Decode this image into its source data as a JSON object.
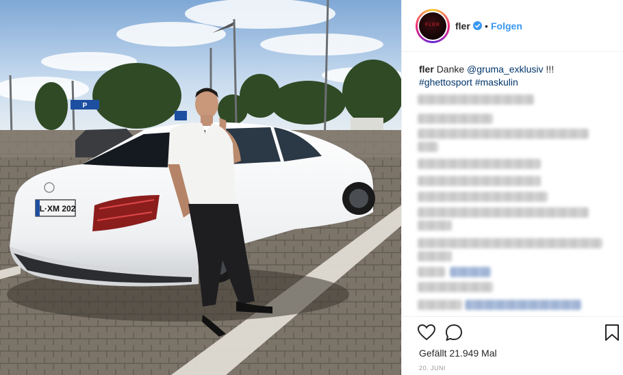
{
  "post": {
    "username": "fler",
    "follow_label": "Folgen",
    "separator": "•",
    "avatar_text": "FLER",
    "caption": {
      "user": "fler",
      "text_before": "Danke",
      "mention": "@gruma_exklusiv",
      "text_after": "!!!",
      "hashtag_1": "#ghettosport",
      "hashtag_2": "#maskulin"
    },
    "likes_label": "Gefällt 21.949 Mal",
    "date_label": "20. JUNI",
    "license_plate": "L·XM 202",
    "road_sign_label": "P"
  },
  "icons": {
    "verified": "verified-badge-icon",
    "like": "heart-icon",
    "comment": "comment-bubble-icon",
    "save": "bookmark-icon"
  },
  "colors": {
    "link_blue": "#3897f0",
    "hashtag": "#003569",
    "text": "#262626",
    "muted": "#999999"
  }
}
